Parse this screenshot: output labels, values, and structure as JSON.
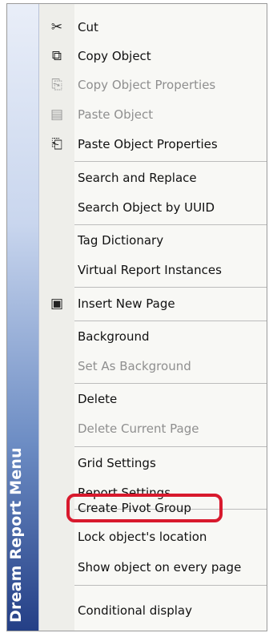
{
  "menu": {
    "brand": "Dream Report Menu",
    "items": [
      {
        "label": "Cut",
        "icon": "scissors-icon",
        "glyph": "✂",
        "disabled": false
      },
      {
        "label": "Copy Object",
        "icon": "copy-icon",
        "glyph": "⧉",
        "disabled": false
      },
      {
        "label": "Copy Object Properties",
        "icon": "copy-properties-icon",
        "glyph": "⎘",
        "disabled": true
      },
      {
        "label": "Paste Object",
        "icon": "paste-icon",
        "glyph": "▤",
        "disabled": true
      },
      {
        "label": "Paste Object Properties",
        "icon": "paste-properties-icon",
        "glyph": "⎗",
        "disabled": false
      },
      {
        "label": "Search and Replace",
        "disabled": false
      },
      {
        "label": "Search Object by UUID",
        "disabled": false
      },
      {
        "label": "Tag Dictionary",
        "disabled": false
      },
      {
        "label": "Virtual Report Instances",
        "disabled": false
      },
      {
        "label": "Insert New Page",
        "icon": "insert-page-icon",
        "glyph": "▣",
        "disabled": false
      },
      {
        "label": "Background",
        "disabled": false
      },
      {
        "label": "Set As Background",
        "disabled": true
      },
      {
        "label": "Delete",
        "disabled": false
      },
      {
        "label": "Delete Current Page",
        "disabled": true
      },
      {
        "label": "Grid Settings",
        "disabled": false
      },
      {
        "label": "Report Settings",
        "disabled": false
      },
      {
        "label": "Create Pivot Group",
        "disabled": false,
        "highlighted": true
      },
      {
        "label": "Lock object's location",
        "disabled": false
      },
      {
        "label": "Show object on every page",
        "disabled": false
      },
      {
        "label": "Conditional display",
        "disabled": false
      }
    ]
  },
  "colors": {
    "highlight_ring": "#d8192d",
    "brand_dark": "#243f86",
    "disabled_text": "#8f8f8f"
  }
}
